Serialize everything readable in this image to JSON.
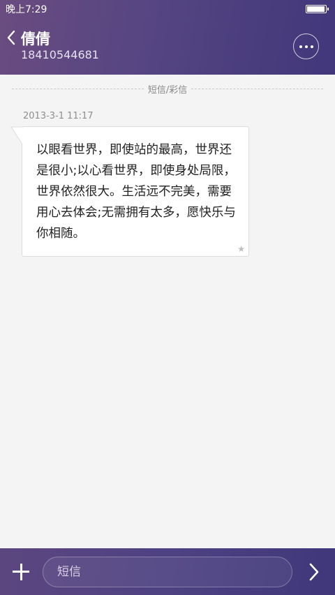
{
  "status_bar": {
    "time": "晚上7:29",
    "battery_level": 0.95,
    "battery_icon": "battery-icon"
  },
  "header": {
    "back_icon": "chevron-left-icon",
    "contact_name": "倩倩",
    "contact_number": "18410544681",
    "more_icon": "more-horizontal-icon"
  },
  "conversation": {
    "type_label": "短信/彩信",
    "messages": [
      {
        "timestamp": "2013-3-1 11:17",
        "text": "以眼看世界，即使站的最高，世界还是很小;以心看世界，即使身处局限，世界依然很大。生活远不完美，需要用心去体会;无需拥有太多，愿快乐与你相随。",
        "star_icon": "star-icon"
      }
    ]
  },
  "composer": {
    "add_icon": "plus-icon",
    "placeholder": "短信",
    "value": "",
    "send_icon": "chevron-right-icon"
  },
  "colors": {
    "header_gradient_start": "#6a4c80",
    "header_gradient_end": "#41377a",
    "background": "#f4f4f4",
    "bubble": "#ffffff"
  }
}
